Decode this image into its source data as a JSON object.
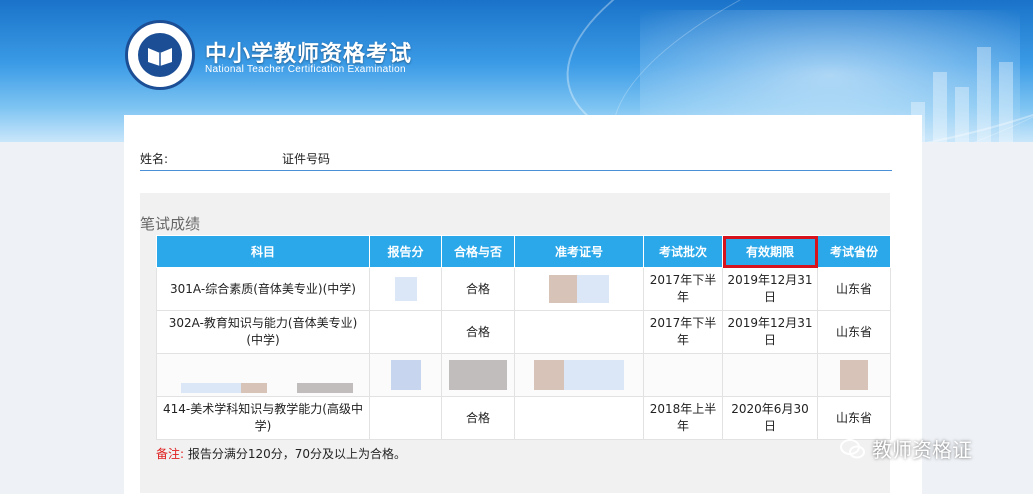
{
  "header": {
    "title_cn": "中小学教师资格考试",
    "title_en": "National Teacher Certification Examination"
  },
  "userbar": {
    "name_label": "姓名:",
    "id_label": "证件号码"
  },
  "section_title": "笔试成绩",
  "table": {
    "headers": [
      "科目",
      "报告分",
      "合格与否",
      "准考证号",
      "考试批次",
      "有效期限",
      "考试省份"
    ],
    "rows": [
      {
        "subject": "301A-综合素质(音体美专业)(中学)",
        "score": "",
        "pass": "合格",
        "ticket": "",
        "batch": "2017年下半年",
        "valid": "2019年12月31日",
        "province": "山东省"
      },
      {
        "subject": "302A-教育知识与能力(音体美专业)(中学)",
        "score": "",
        "pass": "合格",
        "ticket": "",
        "batch": "2017年下半年",
        "valid": "2019年12月31日",
        "province": "山东省"
      },
      {
        "subject": "414-美术学科知识与教学能力(高级中学)",
        "score": "",
        "pass": "合格",
        "ticket": "",
        "batch": "2018年上半年",
        "valid": "2020年6月30日",
        "province": "山东省"
      }
    ]
  },
  "note": {
    "prefix": "备注:",
    "text": "报告分满分120分，70分及以上为合格。"
  },
  "watermark": "教师资格证",
  "colors": {
    "header_blue": "#2aa8ea",
    "highlight_red": "#d6121d",
    "note_red": "#e02020"
  }
}
